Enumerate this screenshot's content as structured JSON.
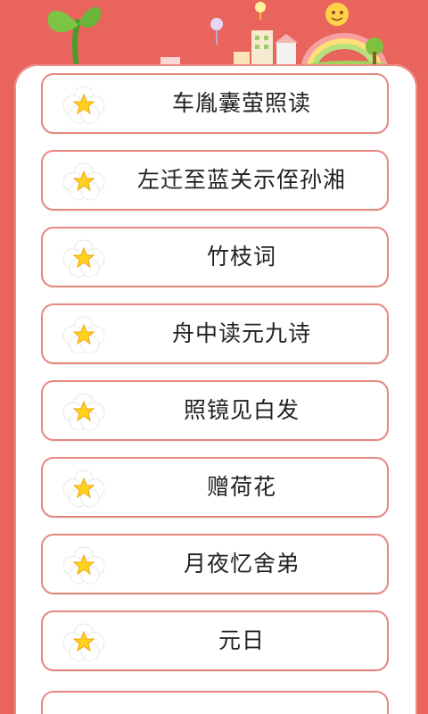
{
  "poems": [
    {
      "title": "车胤囊萤照读"
    },
    {
      "title": "左迁至蓝关示侄孙湘"
    },
    {
      "title": "竹枝词"
    },
    {
      "title": "舟中读元九诗"
    },
    {
      "title": "照镜见白发"
    },
    {
      "title": "赠荷花"
    },
    {
      "title": "月夜忆舍弟"
    },
    {
      "title": "元日"
    }
  ],
  "colors": {
    "background": "#e8645c",
    "item_border": "#e78680",
    "star": "#ffd21f"
  },
  "icons": {
    "list_item_icon": "flower-star-icon",
    "header_left": "sprout-icon",
    "header_right": "sun-icon"
  }
}
